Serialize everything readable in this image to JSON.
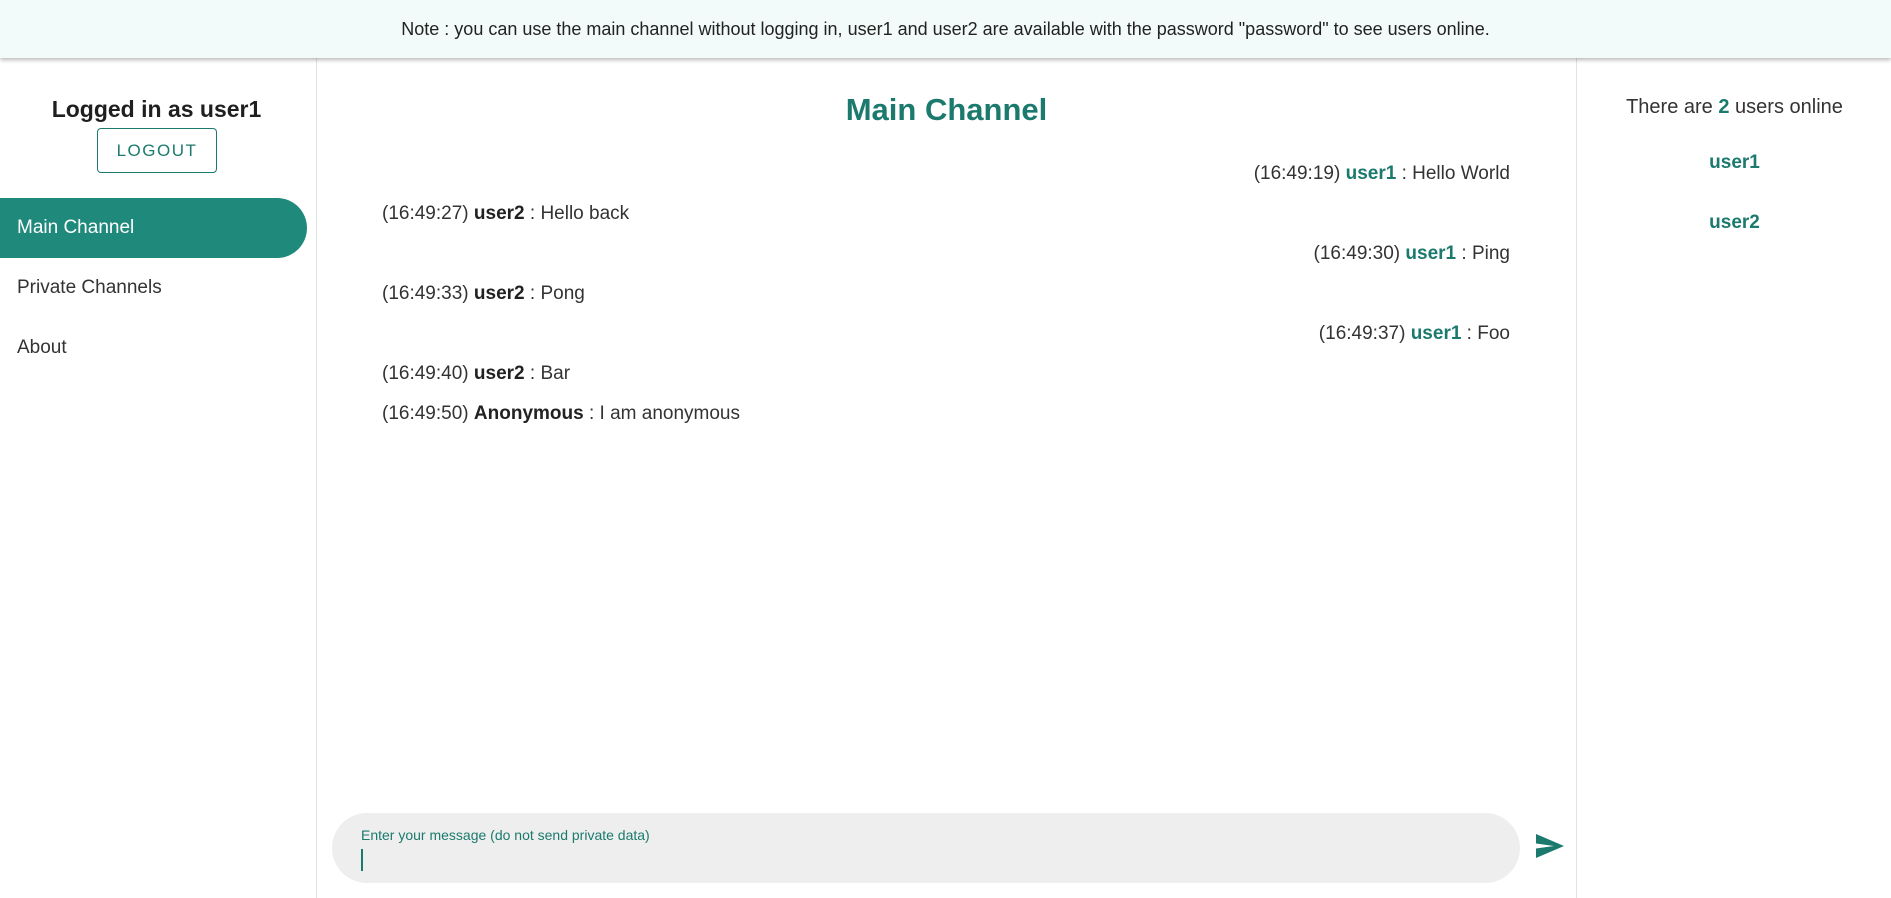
{
  "notice": {
    "text": "Note : you can use the main channel without logging in, user1 and user2 are available with the password \"password\" to see users online."
  },
  "sidebar": {
    "logged_in_label": "Logged in as user1",
    "logout_label": "LOGOUT",
    "nav_items": [
      {
        "label": "Main Channel",
        "active": true
      },
      {
        "label": "Private Channels",
        "active": false
      },
      {
        "label": "About",
        "active": false
      }
    ]
  },
  "channel": {
    "title": "Main Channel",
    "messages": [
      {
        "time": "(16:49:19)",
        "author": "user1",
        "text": "Hello World",
        "align": "right"
      },
      {
        "time": "(16:49:27)",
        "author": "user2",
        "text": "Hello back",
        "align": "left"
      },
      {
        "time": "(16:49:30)",
        "author": "user1",
        "text": "Ping",
        "align": "right"
      },
      {
        "time": "(16:49:33)",
        "author": "user2",
        "text": "Pong",
        "align": "left"
      },
      {
        "time": "(16:49:37)",
        "author": "user1",
        "text": "Foo",
        "align": "right"
      },
      {
        "time": "(16:49:40)",
        "author": "user2",
        "text": "Bar",
        "align": "left"
      },
      {
        "time": "(16:49:50)",
        "author": "Anonymous",
        "text": "I am anonymous",
        "align": "left"
      }
    ],
    "separator": " : "
  },
  "composer": {
    "label": "Enter your message (do not send private data)",
    "value": "",
    "send_icon": "send-icon"
  },
  "online": {
    "prefix": "There are ",
    "count": "2",
    "suffix": " users online",
    "users": [
      "user1",
      "user2"
    ]
  },
  "colors": {
    "accent": "#1b7a6d",
    "active_nav": "#1f8a7b",
    "notice_bg": "#f2fbf9",
    "composer_bg": "#eeeeee"
  }
}
